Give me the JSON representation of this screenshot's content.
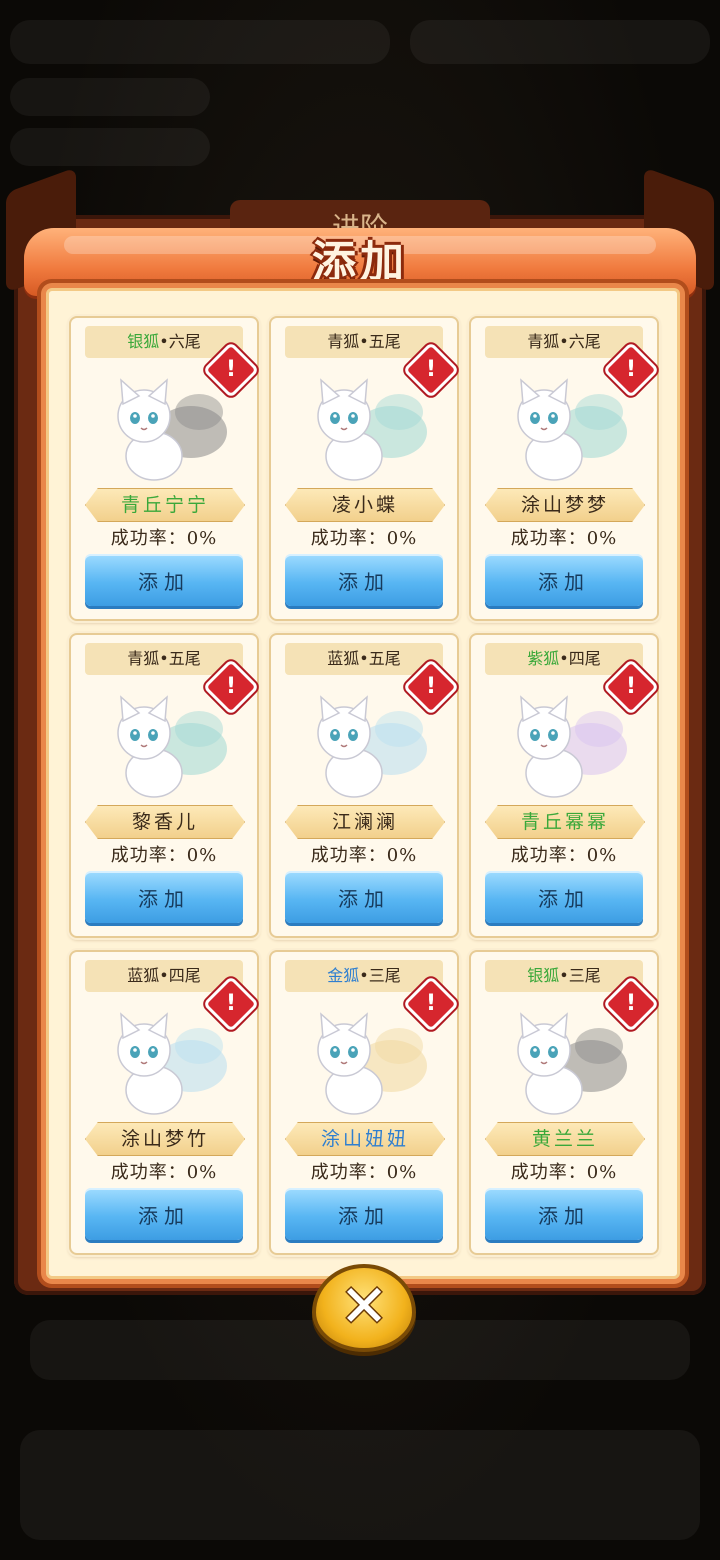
{
  "modal": {
    "title": "添加",
    "background_tab": "进阶",
    "close_icon": "close-icon"
  },
  "cards": [
    {
      "type": "银狐",
      "tails": "六尾",
      "name": "青丘宁宁",
      "rate": "成功率：0%",
      "button": "添加",
      "type_color": "#3aa83a",
      "name_color": "#3aa83a",
      "fox_color": "#8a8a8a"
    },
    {
      "type": "青狐",
      "tails": "五尾",
      "name": "凌小蝶",
      "rate": "成功率：0%",
      "button": "添加",
      "type_color": "#3a2a1a",
      "name_color": "#3a2a1a",
      "fox_color": "#9fd8d4"
    },
    {
      "type": "青狐",
      "tails": "六尾",
      "name": "涂山梦梦",
      "rate": "成功率：0%",
      "button": "添加",
      "type_color": "#3a2a1a",
      "name_color": "#3a2a1a",
      "fox_color": "#9fd8d4"
    },
    {
      "type": "青狐",
      "tails": "五尾",
      "name": "黎香儿",
      "rate": "成功率：0%",
      "button": "添加",
      "type_color": "#3a2a1a",
      "name_color": "#3a2a1a",
      "fox_color": "#9fd8d4"
    },
    {
      "type": "蓝狐",
      "tails": "五尾",
      "name": "江澜澜",
      "rate": "成功率：0%",
      "button": "添加",
      "type_color": "#3a2a1a",
      "name_color": "#3a2a1a",
      "fox_color": "#b8dff0"
    },
    {
      "type": "紫狐",
      "tails": "四尾",
      "name": "青丘幂幂",
      "rate": "成功率：0%",
      "button": "添加",
      "type_color": "#3aa83a",
      "name_color": "#3aa83a",
      "fox_color": "#d8c2f0"
    },
    {
      "type": "蓝狐",
      "tails": "四尾",
      "name": "涂山梦竹",
      "rate": "成功率：0%",
      "button": "添加",
      "type_color": "#3a2a1a",
      "name_color": "#3a2a1a",
      "fox_color": "#b8dff0"
    },
    {
      "type": "金狐",
      "tails": "三尾",
      "name": "涂山妞妞",
      "rate": "成功率：0%",
      "button": "添加",
      "type_color": "#2f7fd0",
      "name_color": "#2f7fd0",
      "fox_color": "#f0d8a0"
    },
    {
      "type": "银狐",
      "tails": "三尾",
      "name": "黄兰兰",
      "rate": "成功率：0%",
      "button": "添加",
      "type_color": "#3aa83a",
      "name_color": "#3aa83a",
      "fox_color": "#8a8a8a"
    }
  ]
}
